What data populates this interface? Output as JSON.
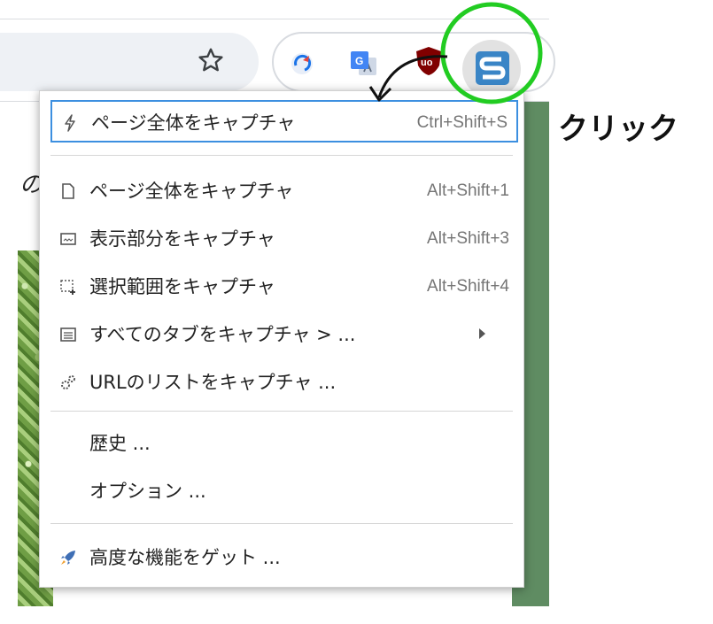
{
  "toolbar": {
    "star_icon": "star-outline-icon",
    "extensions": [
      "refresh-extension-icon",
      "google-translate-icon",
      "ublock-origin-icon",
      "screenshot-s-extension-icon"
    ]
  },
  "page": {
    "fragment_text": "の"
  },
  "menu": {
    "highlight_color": "#3c8fe0",
    "items": [
      {
        "label": "ページ全体をキャプチャ",
        "shortcut": "Ctrl+Shift+S",
        "icon": "lightning-icon"
      },
      {
        "label": "ページ全体をキャプチャ",
        "shortcut": "Alt+Shift+1",
        "icon": "page-icon"
      },
      {
        "label": "表示部分をキャプチャ",
        "shortcut": "Alt+Shift+3",
        "icon": "visible-area-icon"
      },
      {
        "label": "選択範囲をキャプチャ",
        "shortcut": "Alt+Shift+4",
        "icon": "selection-icon"
      },
      {
        "label": "すべてのタブをキャプチャ > ...",
        "shortcut": "",
        "icon": "tabs-icon"
      },
      {
        "label": "URLのリストをキャプチャ ...",
        "shortcut": "",
        "icon": "url-list-icon"
      },
      {
        "label": "歴史 ...",
        "shortcut": "",
        "icon": ""
      },
      {
        "label": "オプション ...",
        "shortcut": "",
        "icon": ""
      },
      {
        "label": "高度な機能をゲット ...",
        "shortcut": "",
        "icon": "rocket-icon"
      }
    ]
  },
  "annotation": {
    "click_text": "クリック",
    "circle_color": "#22cc22"
  }
}
